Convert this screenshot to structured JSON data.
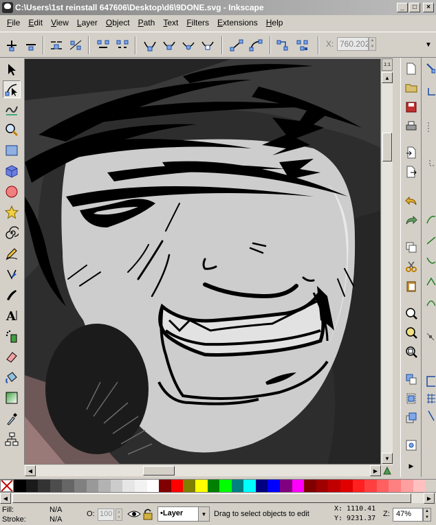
{
  "window": {
    "title": "C:\\Users\\1st reinstall 647606\\Desktop\\d6\\9DONE.svg - Inkscape",
    "minimize": "_",
    "maximize": "□",
    "close": "×"
  },
  "menu": [
    "File",
    "Edit",
    "View",
    "Layer",
    "Object",
    "Path",
    "Text",
    "Filters",
    "Extensions",
    "Help"
  ],
  "node_toolbar": {
    "x_label": "X:",
    "x_value": "760.202"
  },
  "canvas": {
    "zoom_corner_label": "1:1"
  },
  "palette": {
    "colors": [
      "#000000",
      "#1a1a1a",
      "#333333",
      "#4d4d4d",
      "#666666",
      "#808080",
      "#999999",
      "#b3b3b3",
      "#cccccc",
      "#e6e6e6",
      "#f2f2f2",
      "#ffffff",
      "#800000",
      "#ff0000",
      "#808000",
      "#ffff00",
      "#008000",
      "#00ff00",
      "#008080",
      "#00ffff",
      "#000080",
      "#0000ff",
      "#800080",
      "#ff00ff",
      "#800000",
      "#a00000",
      "#c00000",
      "#e00000",
      "#ff2020",
      "#ff4040",
      "#ff6060",
      "#ff8080",
      "#ffa0a0",
      "#ffc0c0"
    ]
  },
  "status": {
    "fill_label": "Fill:",
    "fill_value": "N/A",
    "stroke_label": "Stroke:",
    "stroke_value": "N/A",
    "opacity_label": "O:",
    "opacity_value": "100",
    "layer": "•Layer",
    "message": "Drag to select objects to edit",
    "cursor_x": "X: 1110.41",
    "cursor_y": "Y: 9231.37",
    "zoom_label": "Z:",
    "zoom_value": "47%"
  }
}
